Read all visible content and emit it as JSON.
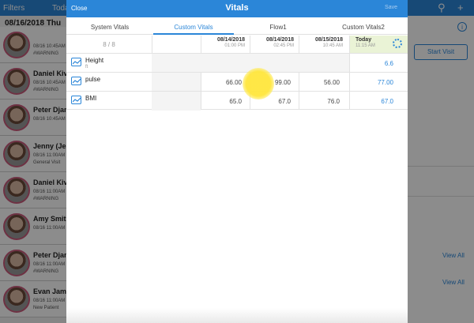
{
  "app": {
    "nav": {
      "filters": "Filters",
      "today": "Toda"
    },
    "date_header": "08/16/2018 Thu",
    "patients": [
      {
        "name": "",
        "sub": "08/16 10:45AM",
        "tag": "#WARNING"
      },
      {
        "name": "Daniel Kiva",
        "sub": "08/16 10:45AM",
        "tag": "#WARNING"
      },
      {
        "name": "Peter Djan",
        "sub": "08/16 10:45AM",
        "tag": ""
      },
      {
        "name": "Jenny (Jen",
        "sub": "08/16 11:00AM",
        "tag": "General Visit"
      },
      {
        "name": "Daniel Kiva",
        "sub": "08/16 11:00AM",
        "tag": "#WARNING"
      },
      {
        "name": "Amy Smith",
        "sub": "08/16 11:00AM",
        "tag": ""
      },
      {
        "name": "Peter Djan",
        "sub": "08/16 11:00AM",
        "tag": "#WARNING"
      },
      {
        "name": "Evan James",
        "sub": "08/16 11:00AM",
        "tag": "New Patient"
      }
    ],
    "right": {
      "start_visit": "Start Visit",
      "view_all_1": "View All",
      "view_all_2": "View All"
    }
  },
  "modal": {
    "close_label": "Close",
    "title": "Vitals",
    "save_label": "Save",
    "tabs": [
      "System Vitals",
      "Custom Vitals",
      "Flow1",
      "Custom Vitals2"
    ],
    "active_tab": "Custom Vitals",
    "count": "8 / 8",
    "columns": [
      {
        "date": "08/14/2018",
        "time": "01:00 PM"
      },
      {
        "date": "08/14/2018",
        "time": "02:45 PM"
      },
      {
        "date": "08/15/2018",
        "time": "10:45 AM"
      }
    ],
    "today": {
      "label": "Today",
      "time": "11:15 AM"
    },
    "rows": [
      {
        "name": "Height",
        "unit": "ft",
        "values": [
          "",
          "",
          "",
          "6.6"
        ]
      },
      {
        "name": "pulse",
        "unit": "",
        "values": [
          "66.00",
          "99.00",
          "56.00",
          "77.00"
        ]
      },
      {
        "name": "BMI",
        "unit": "",
        "values": [
          "65.0",
          "67.0",
          "76.0",
          "67.0"
        ]
      }
    ]
  },
  "colors": {
    "accent": "#2b86d8",
    "today_bg": "#eaf3d6",
    "touch": "#ffe63c"
  }
}
